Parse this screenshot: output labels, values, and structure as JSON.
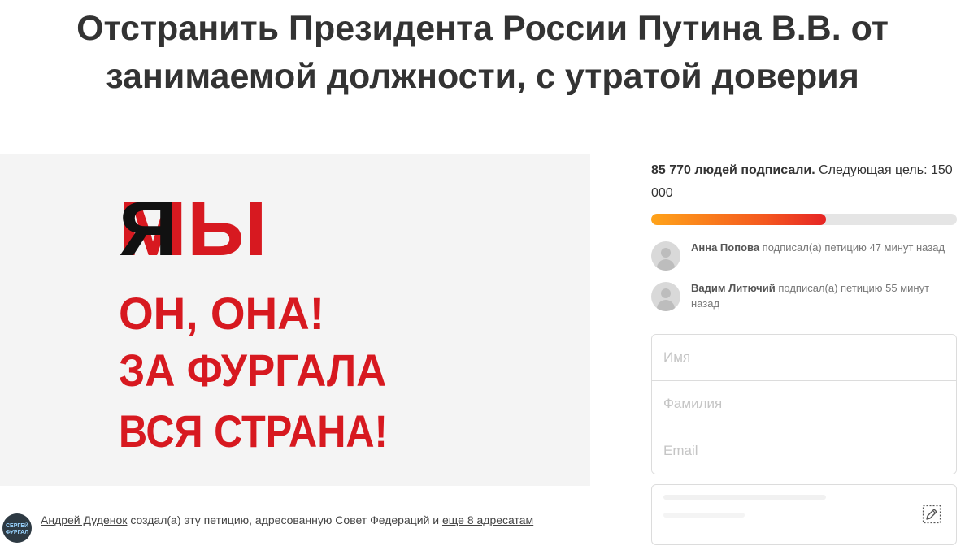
{
  "petition": {
    "title": "Отстранить Президента России Путина В.В. от занимаемой должности, с утратой доверия"
  },
  "hero_image": {
    "line1_black": "Я",
    "line1_red": "МЫ",
    "line2": "ОН, ОНА!",
    "line3": "ЗА ФУРГАЛА",
    "line4": "ВСЯ СТРАНА!",
    "colors": {
      "red": "#d71920",
      "black": "#111111",
      "background": "#f4f4f4"
    }
  },
  "author": {
    "avatar_text_line1": "СЕРГЕЙ",
    "avatar_text_line2": "ФУРГАЛ",
    "name": "Андрей Дуденок",
    "text_middle": " создал(а) эту петицию, адресованную Совет Федераций и ",
    "more_link": "еще 8 адресатам"
  },
  "progress": {
    "count_bold": "85 770 людей подписали.",
    "count_rest": " Следующая цель: 150 000",
    "signed": 85770,
    "goal": 150000,
    "fraction": 0.5718
  },
  "recent_signers": [
    {
      "name": "Анна Попова",
      "action": " подписал(а) петицию 47 минут назад"
    },
    {
      "name": "Вадим Литючий",
      "action": " подписал(а) петицию 55 минут назад"
    }
  ],
  "form": {
    "first_name_placeholder": "Имя",
    "last_name_placeholder": "Фамилия",
    "email_placeholder": "Email"
  },
  "comment": {
    "icon": "edit-icon"
  }
}
